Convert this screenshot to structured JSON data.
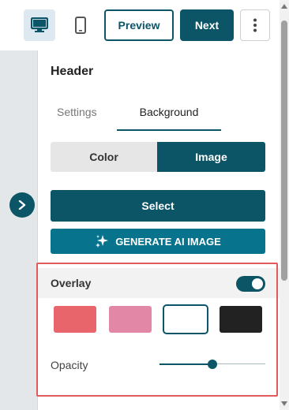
{
  "toolbar": {
    "devices": [
      {
        "name": "desktop",
        "icon": "desktop-icon",
        "selected": true
      },
      {
        "name": "mobile",
        "icon": "mobile-icon",
        "selected": false
      }
    ],
    "preview_label": "Preview",
    "next_label": "Next",
    "more_icon": "more-vertical-icon"
  },
  "left_strip": {
    "expand_icon": "chevron-right-icon"
  },
  "panel": {
    "title": "Header",
    "tabs": [
      {
        "label": "Settings",
        "active": false
      },
      {
        "label": "Background",
        "active": true
      }
    ],
    "background_type": {
      "options": [
        "Color",
        "Image"
      ],
      "selected": "Image"
    },
    "select_label": "Select",
    "ai_button": {
      "label": "GENERATE AI IMAGE",
      "icon": "sparkle-icon"
    },
    "overlay": {
      "title": "Overlay",
      "enabled": true,
      "swatches": [
        {
          "color": "#e8666b",
          "selected": false
        },
        {
          "color": "#e287a5",
          "selected": false
        },
        {
          "color": "#ffffff",
          "selected": true
        },
        {
          "color": "#222222",
          "selected": false
        }
      ],
      "opacity_label": "Opacity",
      "opacity_value": 0.5
    }
  },
  "colors": {
    "accent": "#0b5567",
    "ai_button": "#08738c",
    "highlight": "#e05a5e"
  }
}
